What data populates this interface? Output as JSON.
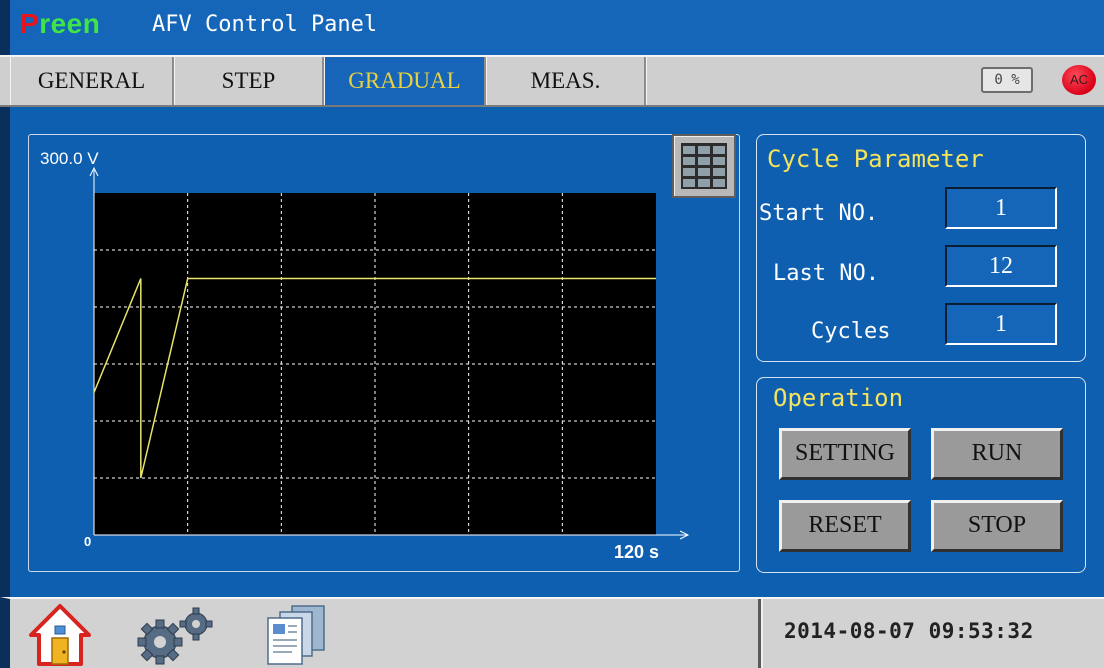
{
  "title_bar": {
    "brand_first_letter": "P",
    "brand_rest": "reen",
    "app_title": "AFV Control Panel",
    "brand_colors": {
      "first_letter": "#e8141c",
      "rest": "#3fe34a"
    }
  },
  "tabs": [
    {
      "label": "GENERAL",
      "active": false
    },
    {
      "label": "STEP",
      "active": false
    },
    {
      "label": "GRADUAL",
      "active": true
    },
    {
      "label": "MEAS.",
      "active": false
    }
  ],
  "status": {
    "percent": "0 %",
    "ac_indicator": "AC",
    "ac_color": "#d80018"
  },
  "chart": {
    "y_max_label": "300.0 V",
    "origin_label": "0",
    "x_max_label": "120 s",
    "calculator_icon": "calculator-table-icon"
  },
  "chart_data": {
    "type": "line",
    "series": [
      {
        "values": [
          [
            0,
            125
          ],
          [
            10,
            225
          ],
          [
            10,
            50
          ],
          [
            20,
            225
          ],
          [
            120,
            225
          ]
        ]
      }
    ],
    "xlim": [
      0,
      120
    ],
    "ylim": [
      0,
      300
    ],
    "grid": true,
    "background": "#000000",
    "line_color": "#e8e36a"
  },
  "cycle_parameter": {
    "title": "Cycle Parameter",
    "start_label": "Start NO.",
    "start_value": "1",
    "last_label": "Last NO.",
    "last_value": "12",
    "cycles_label": "Cycles",
    "cycles_value": "1"
  },
  "operation": {
    "title": "Operation",
    "setting": "SETTING",
    "run": "RUN",
    "reset": "RESET",
    "stop": "STOP"
  },
  "bottom_bar": {
    "home_icon": "home-icon",
    "settings_icon": "gears-icon",
    "documents_icon": "documents-icon",
    "datetime": "2014-08-07 09:53:32"
  },
  "colors": {
    "panel_blue": "#0e5fb0",
    "tab_active_text": "#e9d240",
    "group_title": "#f5e35a"
  }
}
